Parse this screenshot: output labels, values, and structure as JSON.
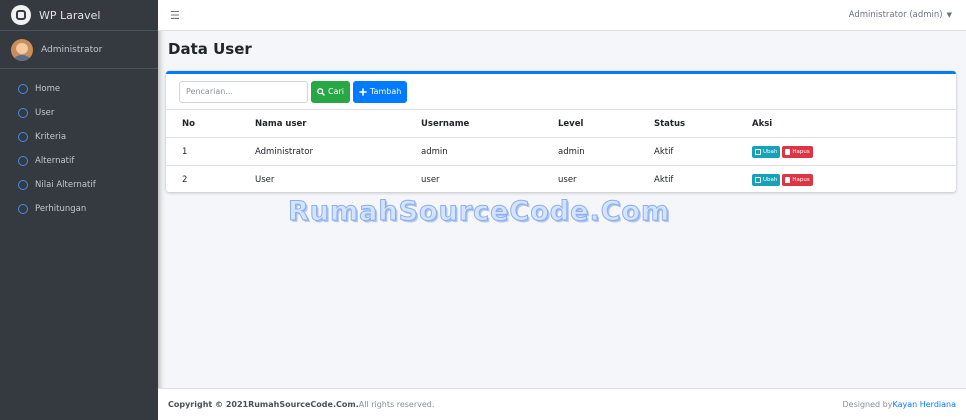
{
  "brand": {
    "name": "WP Laravel",
    "icon": "laravel-logo-icon"
  },
  "user_panel": {
    "name": "Administrator",
    "avatar": "avatar"
  },
  "sidebar": {
    "items": [
      {
        "label": "Home",
        "icon": "circle-icon"
      },
      {
        "label": "User",
        "icon": "circle-icon"
      },
      {
        "label": "Kriteria",
        "icon": "circle-icon"
      },
      {
        "label": "Alternatif",
        "icon": "circle-icon"
      },
      {
        "label": "Nilai Alternatif",
        "icon": "circle-icon"
      },
      {
        "label": "Perhitungan",
        "icon": "circle-icon"
      }
    ]
  },
  "topbar": {
    "menu_icon": "hamburger-icon",
    "user_menu": "Administrator (admin)"
  },
  "page": {
    "title": "Data User"
  },
  "toolbar": {
    "search_placeholder": "Pencarian...",
    "search_button": "Cari",
    "add_button": "Tambah"
  },
  "table": {
    "headers": [
      "No",
      "Nama user",
      "Username",
      "Level",
      "Status",
      "Aksi"
    ],
    "rows": [
      {
        "no": "1",
        "name": "Administrator",
        "username": "admin",
        "level": "admin",
        "status": "Aktif"
      },
      {
        "no": "2",
        "name": "User",
        "username": "user",
        "level": "user",
        "status": "Aktif"
      }
    ],
    "edit_label": "Ubah",
    "delete_label": "Hapus"
  },
  "watermark": "RumahSourceCode.Com",
  "footer": {
    "copyright_prefix": "Copyright © 2021",
    "site": "RumahSourceCode.Com.",
    "rights": "All rights reserved.",
    "designed_by": "Designed by",
    "author": "Kayan Herdiana"
  },
  "colors": {
    "sidebar": "#343a40",
    "primary": "#007bff",
    "success": "#28a745",
    "info": "#17a2b8",
    "danger": "#dc3545"
  }
}
